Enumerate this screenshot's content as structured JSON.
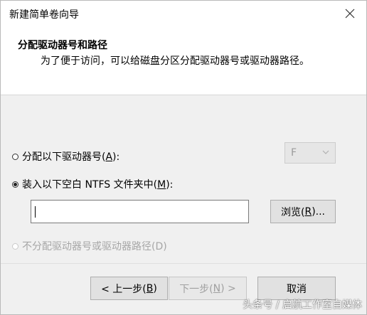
{
  "window": {
    "title": "新建简单卷向导"
  },
  "header": {
    "title": "分配驱动器号和路径",
    "subtitle": "为了便于访问，可以给磁盘分区分配驱动器号或驱动器路径。"
  },
  "options": {
    "assign_letter": {
      "label_pre": "分配以下驱动器号(",
      "mnemonic": "A",
      "label_post": "):",
      "checked": false
    },
    "mount_folder": {
      "label_pre": "装入以下空白 NTFS 文件夹中(",
      "mnemonic": "M",
      "label_post": "):",
      "checked": true
    },
    "no_assign": {
      "label": "不分配驱动器号或驱动器路径(D)",
      "enabled": false
    }
  },
  "drive_select": {
    "value": "F",
    "icon": "chevron-down-icon"
  },
  "path_input": {
    "value": ""
  },
  "browse_button": {
    "label_pre": "浏览(",
    "mnemonic": "R",
    "label_post": ")..."
  },
  "footer": {
    "back_pre": "< 上一步(",
    "back_mnemonic": "B",
    "back_post": ")",
    "next_pre": "下一步(",
    "next_mnemonic": "N",
    "next_post": ") >",
    "cancel": "取消"
  },
  "watermark": "头条号 / 启航工作室自媒体",
  "colors": {
    "window_bg": "#f0f0f0",
    "header_bg": "#ffffff",
    "button_bg": "#e1e1e1",
    "disabled_text": "#a6a6a6"
  }
}
